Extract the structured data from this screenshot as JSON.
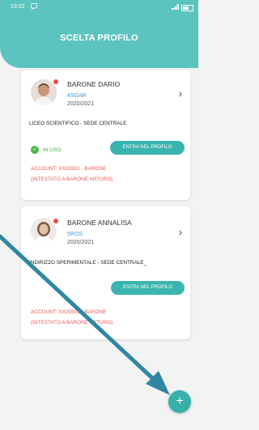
{
  "status_bar": {
    "time": "13:22",
    "notification_icon": "chat-notification-icon",
    "signal": "⁂",
    "battery_icon": "battery-icon"
  },
  "header": {
    "title": "SCELTA PROFILO",
    "color": "#5cc4be"
  },
  "profiles": [
    {
      "name": "BARONE DARIO",
      "class": "4SGAR",
      "year": "2020/2021",
      "school": "LICEO SCIENTIFICO - SEDE CENTRALE",
      "in_use_label": "IN USO",
      "enter_label": "ENTRA NEL PROFILO",
      "account_line1": "ACCOUNT: XX25501 - BARONE",
      "account_line2": "(INTESTATO A BARONE ARTURO)"
    },
    {
      "name": "BARONE ANNALISA",
      "class": "5ROS",
      "year": "2020/2021",
      "school": "INDIRIZZO SPERIMENTALE - SEDE CENTRALE_",
      "enter_label": "ENTRA NEL PROFILO",
      "account_line1": "ACCOUNT: XX25501 - BARONE",
      "account_line2": "(INTESTATO A BARONE ARTURO)"
    }
  ],
  "fab": {
    "label": "+",
    "icon": "plus-icon"
  },
  "colors": {
    "accent": "#39b4ae",
    "link": "#3e9bd8",
    "warning": "#e75a5a",
    "success": "#3cb24a",
    "annotation_arrow": "#2f87a3"
  }
}
